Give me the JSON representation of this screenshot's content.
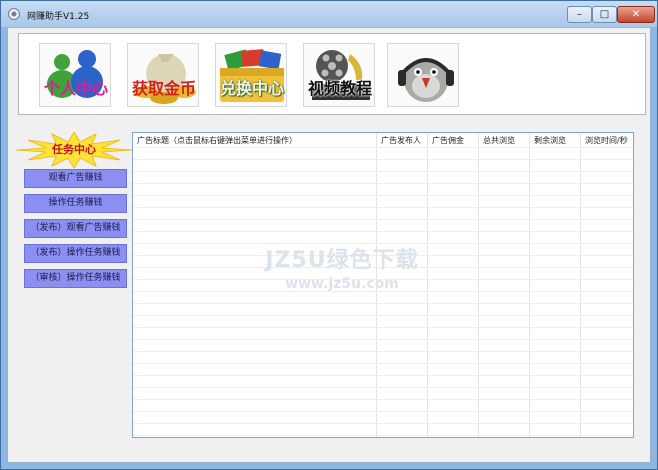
{
  "window": {
    "title": "网赚助手V1.25",
    "controls": {
      "minimize": "–",
      "maximize": "□",
      "close": "✕"
    }
  },
  "toolbar": [
    {
      "label": "个人中心",
      "icon": "users-icon",
      "color": "#e01a9a"
    },
    {
      "label": "获取金币",
      "icon": "coin-bag-icon",
      "color": "#d81f1f"
    },
    {
      "label": "兑换中心",
      "icon": "cards-folder-icon",
      "color": "#f2f2f2"
    },
    {
      "label": "视频教程",
      "icon": "film-reel-icon",
      "color": "#111111"
    },
    {
      "label": "",
      "icon": "bird-headphones-icon"
    }
  ],
  "sidebar": {
    "header": "任务中心",
    "buttons": [
      "观看广告赚钱",
      "操作任务赚钱",
      "（发布）观看广告赚钱",
      "（发布）操作任务赚钱",
      "（审核）操作任务赚钱"
    ]
  },
  "table": {
    "columns": [
      "广告标题（点击鼠标右键弹出菜单进行操作）",
      "广告发布人",
      "广告佣金",
      "总共浏览",
      "剩余浏览",
      "浏览时间/秒"
    ],
    "rows": []
  },
  "watermark": {
    "line1": "JZ5U绿色下载",
    "line2": "www.jz5u.com"
  }
}
